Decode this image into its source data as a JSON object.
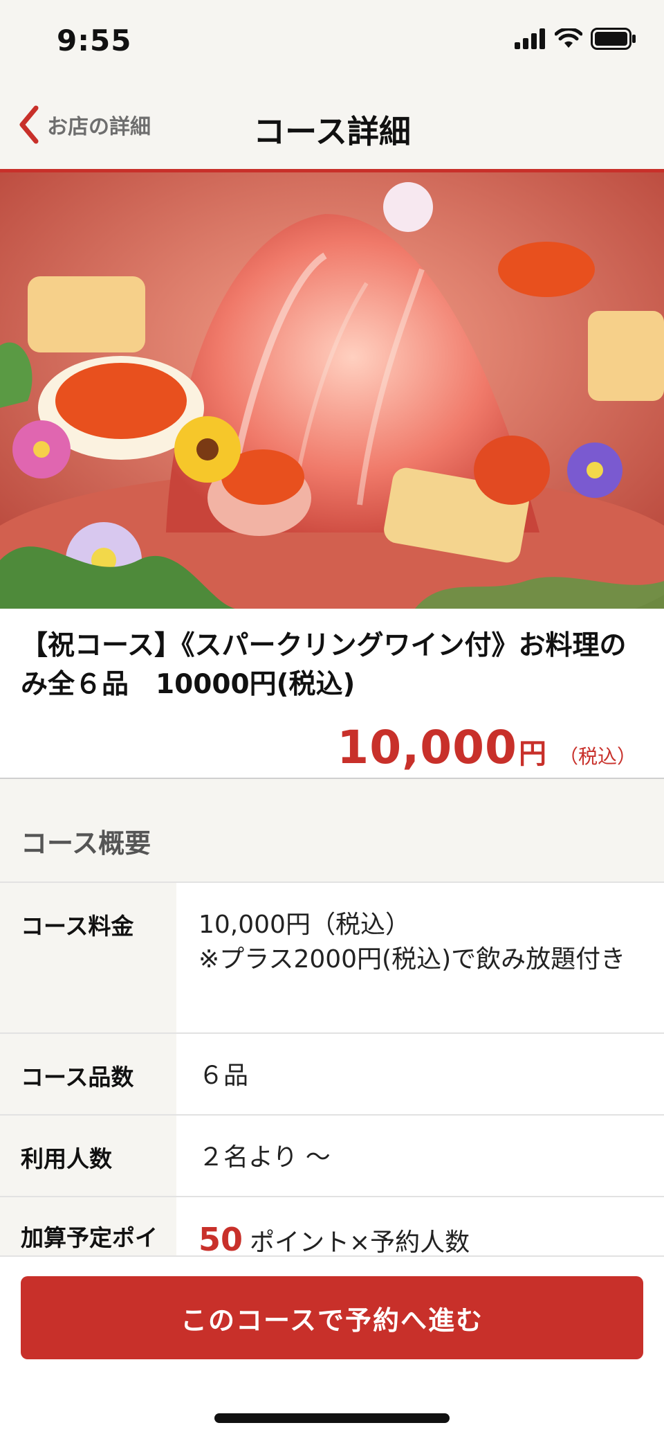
{
  "status_bar": {
    "time": "9:55"
  },
  "nav": {
    "back_label": "お店の詳細",
    "title": "コース詳細"
  },
  "hero": {
    "image_alt": "course-dish-photo"
  },
  "course": {
    "title": "【祝コース】《スパークリングワイン付》お料理のみ全６品　10000円(税込)",
    "price": "10,000",
    "price_unit": "円",
    "price_tax": "（税込）"
  },
  "overview": {
    "section_title": "コース概要",
    "rows": [
      {
        "label": "コース料金",
        "value_line1": "10,000円（税込）",
        "value_line2": "※プラス2000円(税込)で飲み放題付き"
      },
      {
        "label": "コース品数",
        "value": "６品"
      },
      {
        "label": "利用人数",
        "value": "２名より ～"
      },
      {
        "label": "加算予定ポイント",
        "points": "50",
        "value": "ポイント×予約人数"
      }
    ]
  },
  "footer": {
    "reserve_button": "このコースで予約へ進む"
  },
  "colors": {
    "accent": "#c8302a",
    "background": "#f6f5f1"
  }
}
